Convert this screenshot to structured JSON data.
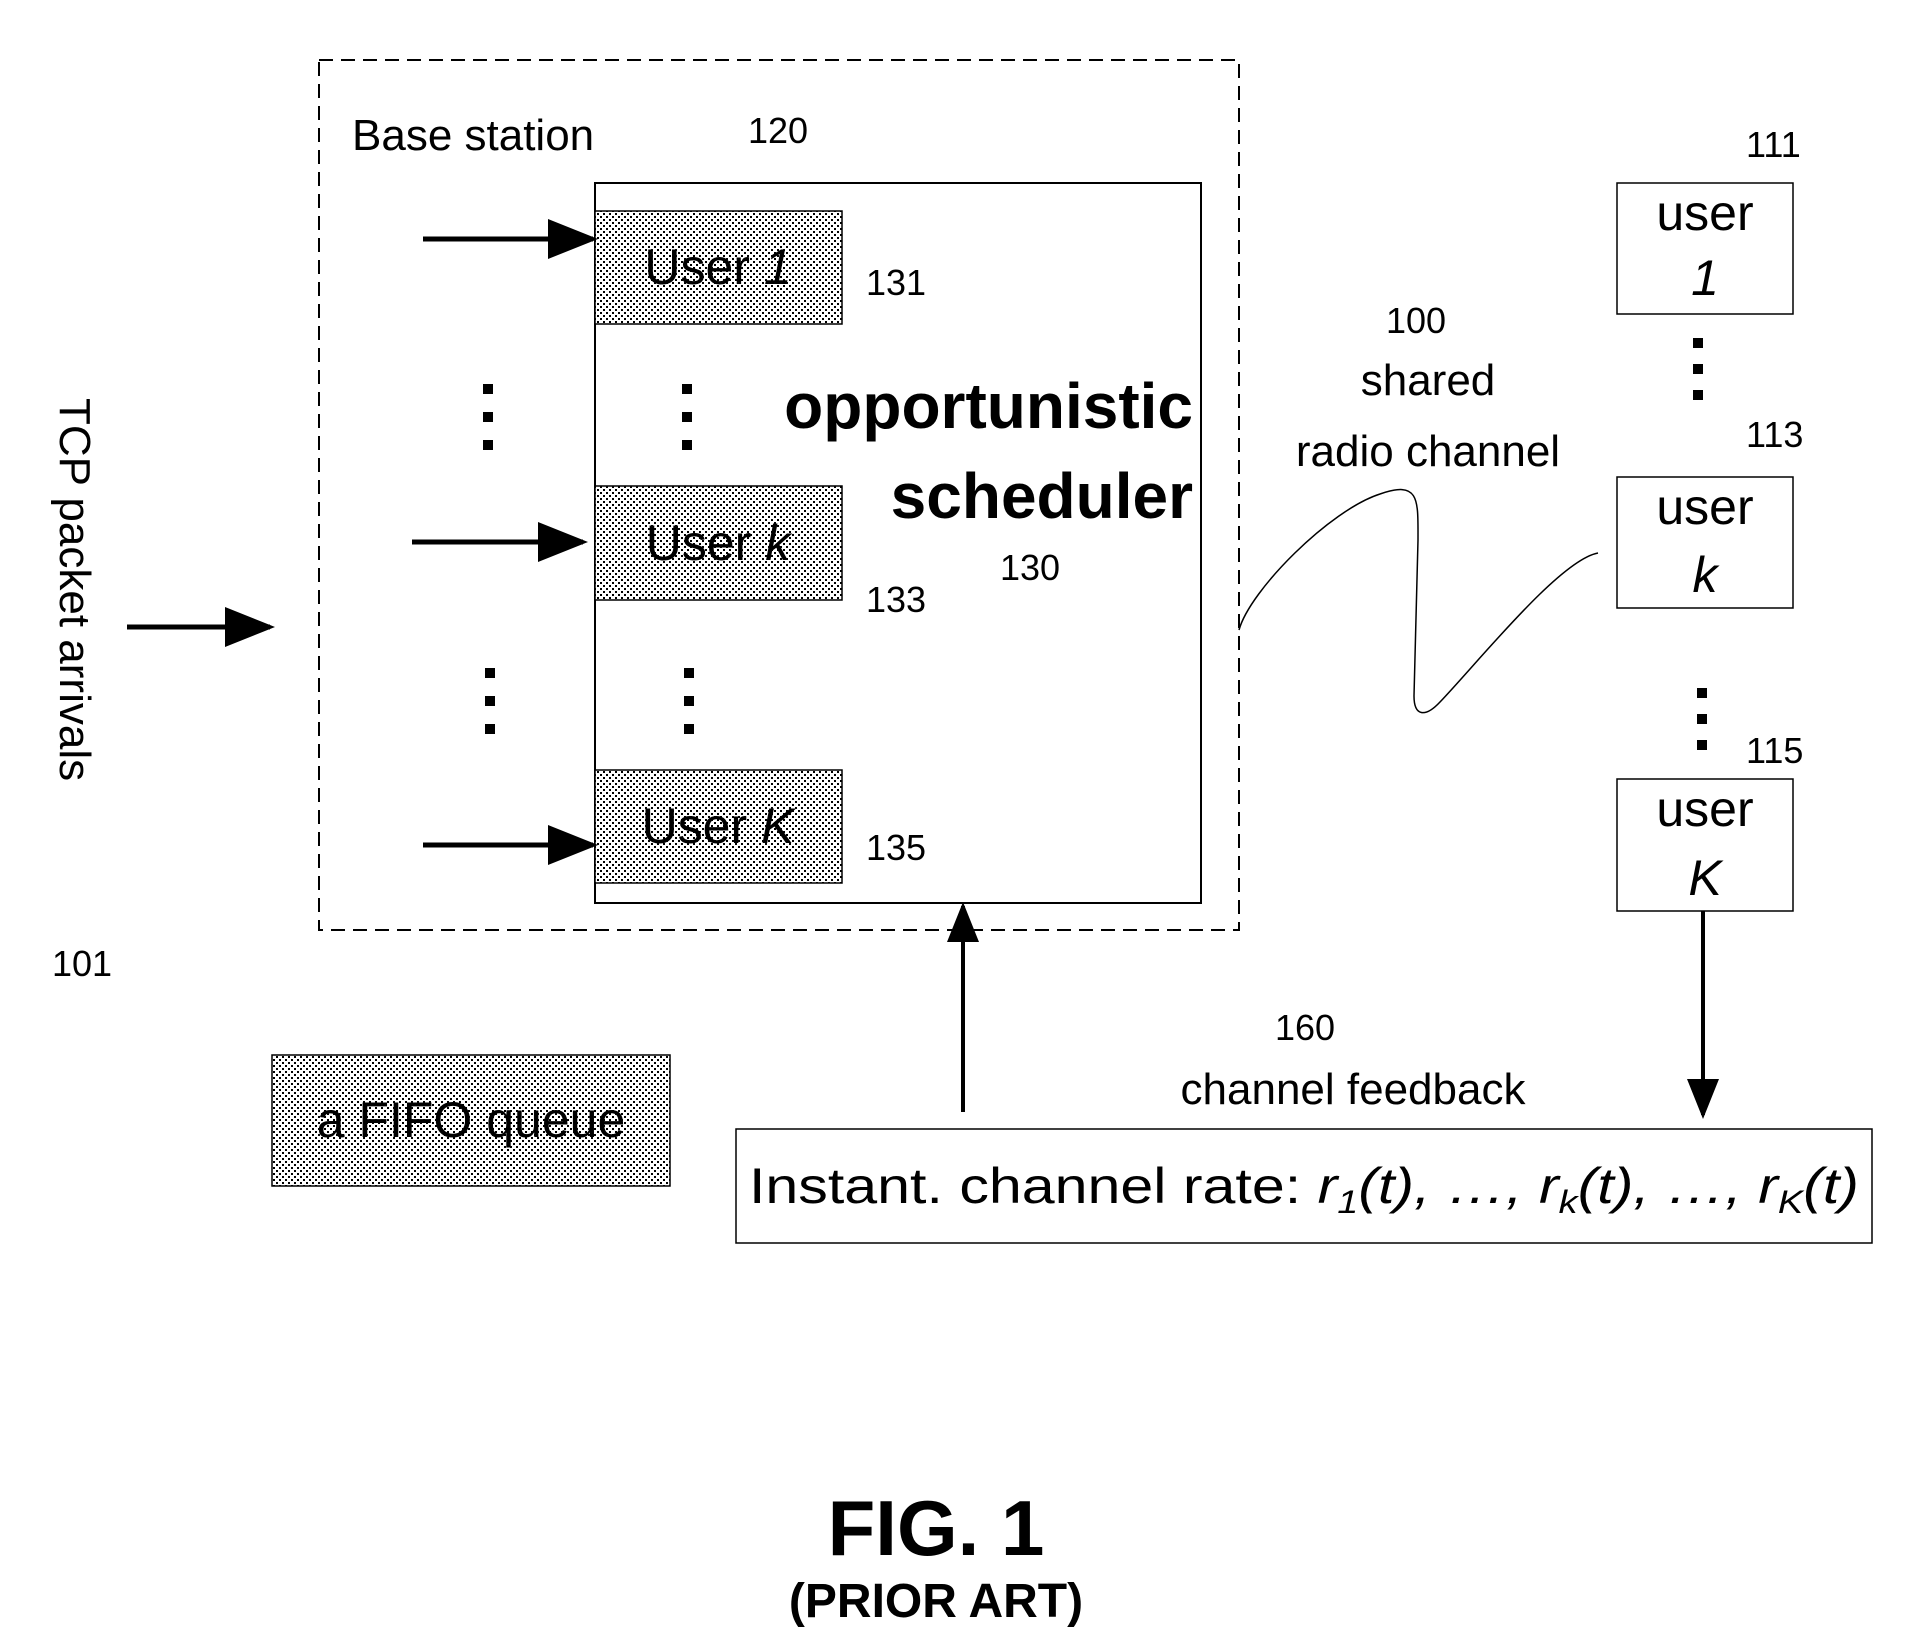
{
  "colors": {
    "ink": "#000000",
    "background": "#ffffff",
    "queue_fill": "#c8c8c8"
  },
  "base_station": {
    "label": "Base station",
    "ref": "120"
  },
  "scheduler": {
    "line1": "opportunistic",
    "line2": "scheduler",
    "ref": "130"
  },
  "queues": [
    {
      "prefix": "User ",
      "index": "1",
      "ref": "131"
    },
    {
      "prefix": "User ",
      "index": "k",
      "ref": "133"
    },
    {
      "prefix": "User ",
      "index": "K",
      "ref": "135"
    }
  ],
  "arrivals": {
    "label": "TCP packet arrivals",
    "ref": "101"
  },
  "channel": {
    "ref": "100",
    "line1": "shared",
    "line2": "radio channel"
  },
  "users": [
    {
      "label": "user",
      "index": "1",
      "ref": "111"
    },
    {
      "label": "user",
      "index": "k",
      "ref": "113"
    },
    {
      "label": "user",
      "index": "K",
      "ref": "115"
    }
  ],
  "feedback": {
    "ref": "160",
    "label": "channel feedback",
    "rate_prefix": "Instant. channel rate: ",
    "r": "r",
    "sub1": "1",
    "subk": "k",
    "subK": "K",
    "t": "(t)",
    "sep": ", …, "
  },
  "legend": {
    "label": "a FIFO queue"
  },
  "caption": {
    "title": "FIG. 1",
    "subtitle": "(PRIOR ART)"
  },
  "ellipsis": "⋮"
}
